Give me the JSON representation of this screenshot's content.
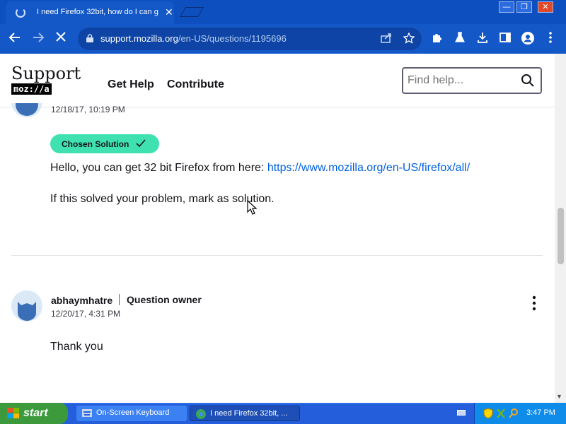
{
  "browser": {
    "tab_title": "I need Firefox 32bit, how do I can ge",
    "tab_close": "✕",
    "url_domain": "support.mozilla.org",
    "url_path": "/en-US/questions/1195696",
    "window_controls": [
      "—",
      "❐",
      "✕"
    ]
  },
  "header": {
    "logo_text": "Support",
    "logo_subtext": "moz://a",
    "nav": [
      "Get Help",
      "Contribute"
    ],
    "search_placeholder": "Find help..."
  },
  "answer": {
    "timestamp": "12/18/17, 10:19 PM",
    "badge_label": "Chosen Solution",
    "line1_text": "Hello, you can get 32 bit Firefox from here: ",
    "line1_link": "https://www.mozilla.org/en-US/firefox/all/",
    "line2_text": "If this solved your problem, mark as solution."
  },
  "reply": {
    "author": "abhaymhatre",
    "role": "Question owner",
    "timestamp": "12/20/17, 4:31 PM",
    "text": "Thank you"
  },
  "taskbar": {
    "start_label": "start",
    "items": [
      {
        "label": "On-Screen Keyboard"
      },
      {
        "label": "I need Firefox 32bit, ..."
      }
    ],
    "clock": "3:47 PM"
  },
  "colors": {
    "accent_blue": "#1458c7",
    "badge_green": "#3fe1b0",
    "link_blue": "#0060df"
  }
}
